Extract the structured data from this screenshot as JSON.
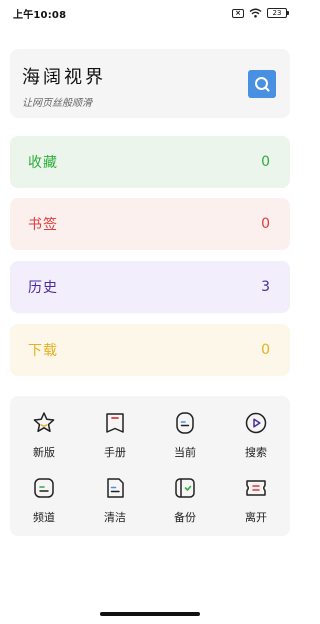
{
  "status_bar": {
    "time": "上午10:08",
    "battery": "23"
  },
  "header": {
    "title": "海阔视界",
    "subtitle": "让网页丝般顺滑",
    "search_icon": "search-icon",
    "accent": "#4a90e2"
  },
  "stats": [
    {
      "label": "收藏",
      "value": "0",
      "color": "#2fae3c",
      "bg": "#ecf5ec"
    },
    {
      "label": "书签",
      "value": "0",
      "color": "#e03a3a",
      "bg": "#fcf0ee"
    },
    {
      "label": "历史",
      "value": "3",
      "color": "#4b2d9e",
      "bg": "#f2eefc"
    },
    {
      "label": "下载",
      "value": "0",
      "color": "#e6b020",
      "bg": "#fdf7ea"
    }
  ],
  "grid": [
    {
      "label": "新版",
      "icon": "star-icon"
    },
    {
      "label": "手册",
      "icon": "book-icon"
    },
    {
      "label": "当前",
      "icon": "current-icon"
    },
    {
      "label": "搜索",
      "icon": "play-icon"
    },
    {
      "label": "频道",
      "icon": "channel-icon"
    },
    {
      "label": "清洁",
      "icon": "clean-icon"
    },
    {
      "label": "备份",
      "icon": "backup-icon"
    },
    {
      "label": "离开",
      "icon": "exit-icon"
    }
  ]
}
